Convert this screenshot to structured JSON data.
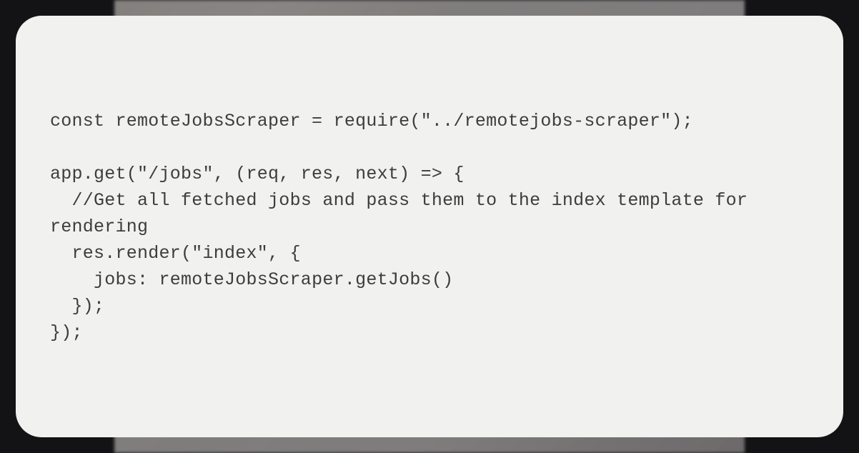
{
  "code": {
    "lines": [
      "const remoteJobsScraper = require(\"../remotejobs-scraper\");",
      "",
      "app.get(\"/jobs\", (req, res, next) => {",
      "  //Get all fetched jobs and pass them to the index template for rendering",
      "  res.render(\"index\", {",
      "    jobs: remoteJobsScraper.getJobs()",
      "  });",
      "});"
    ]
  }
}
